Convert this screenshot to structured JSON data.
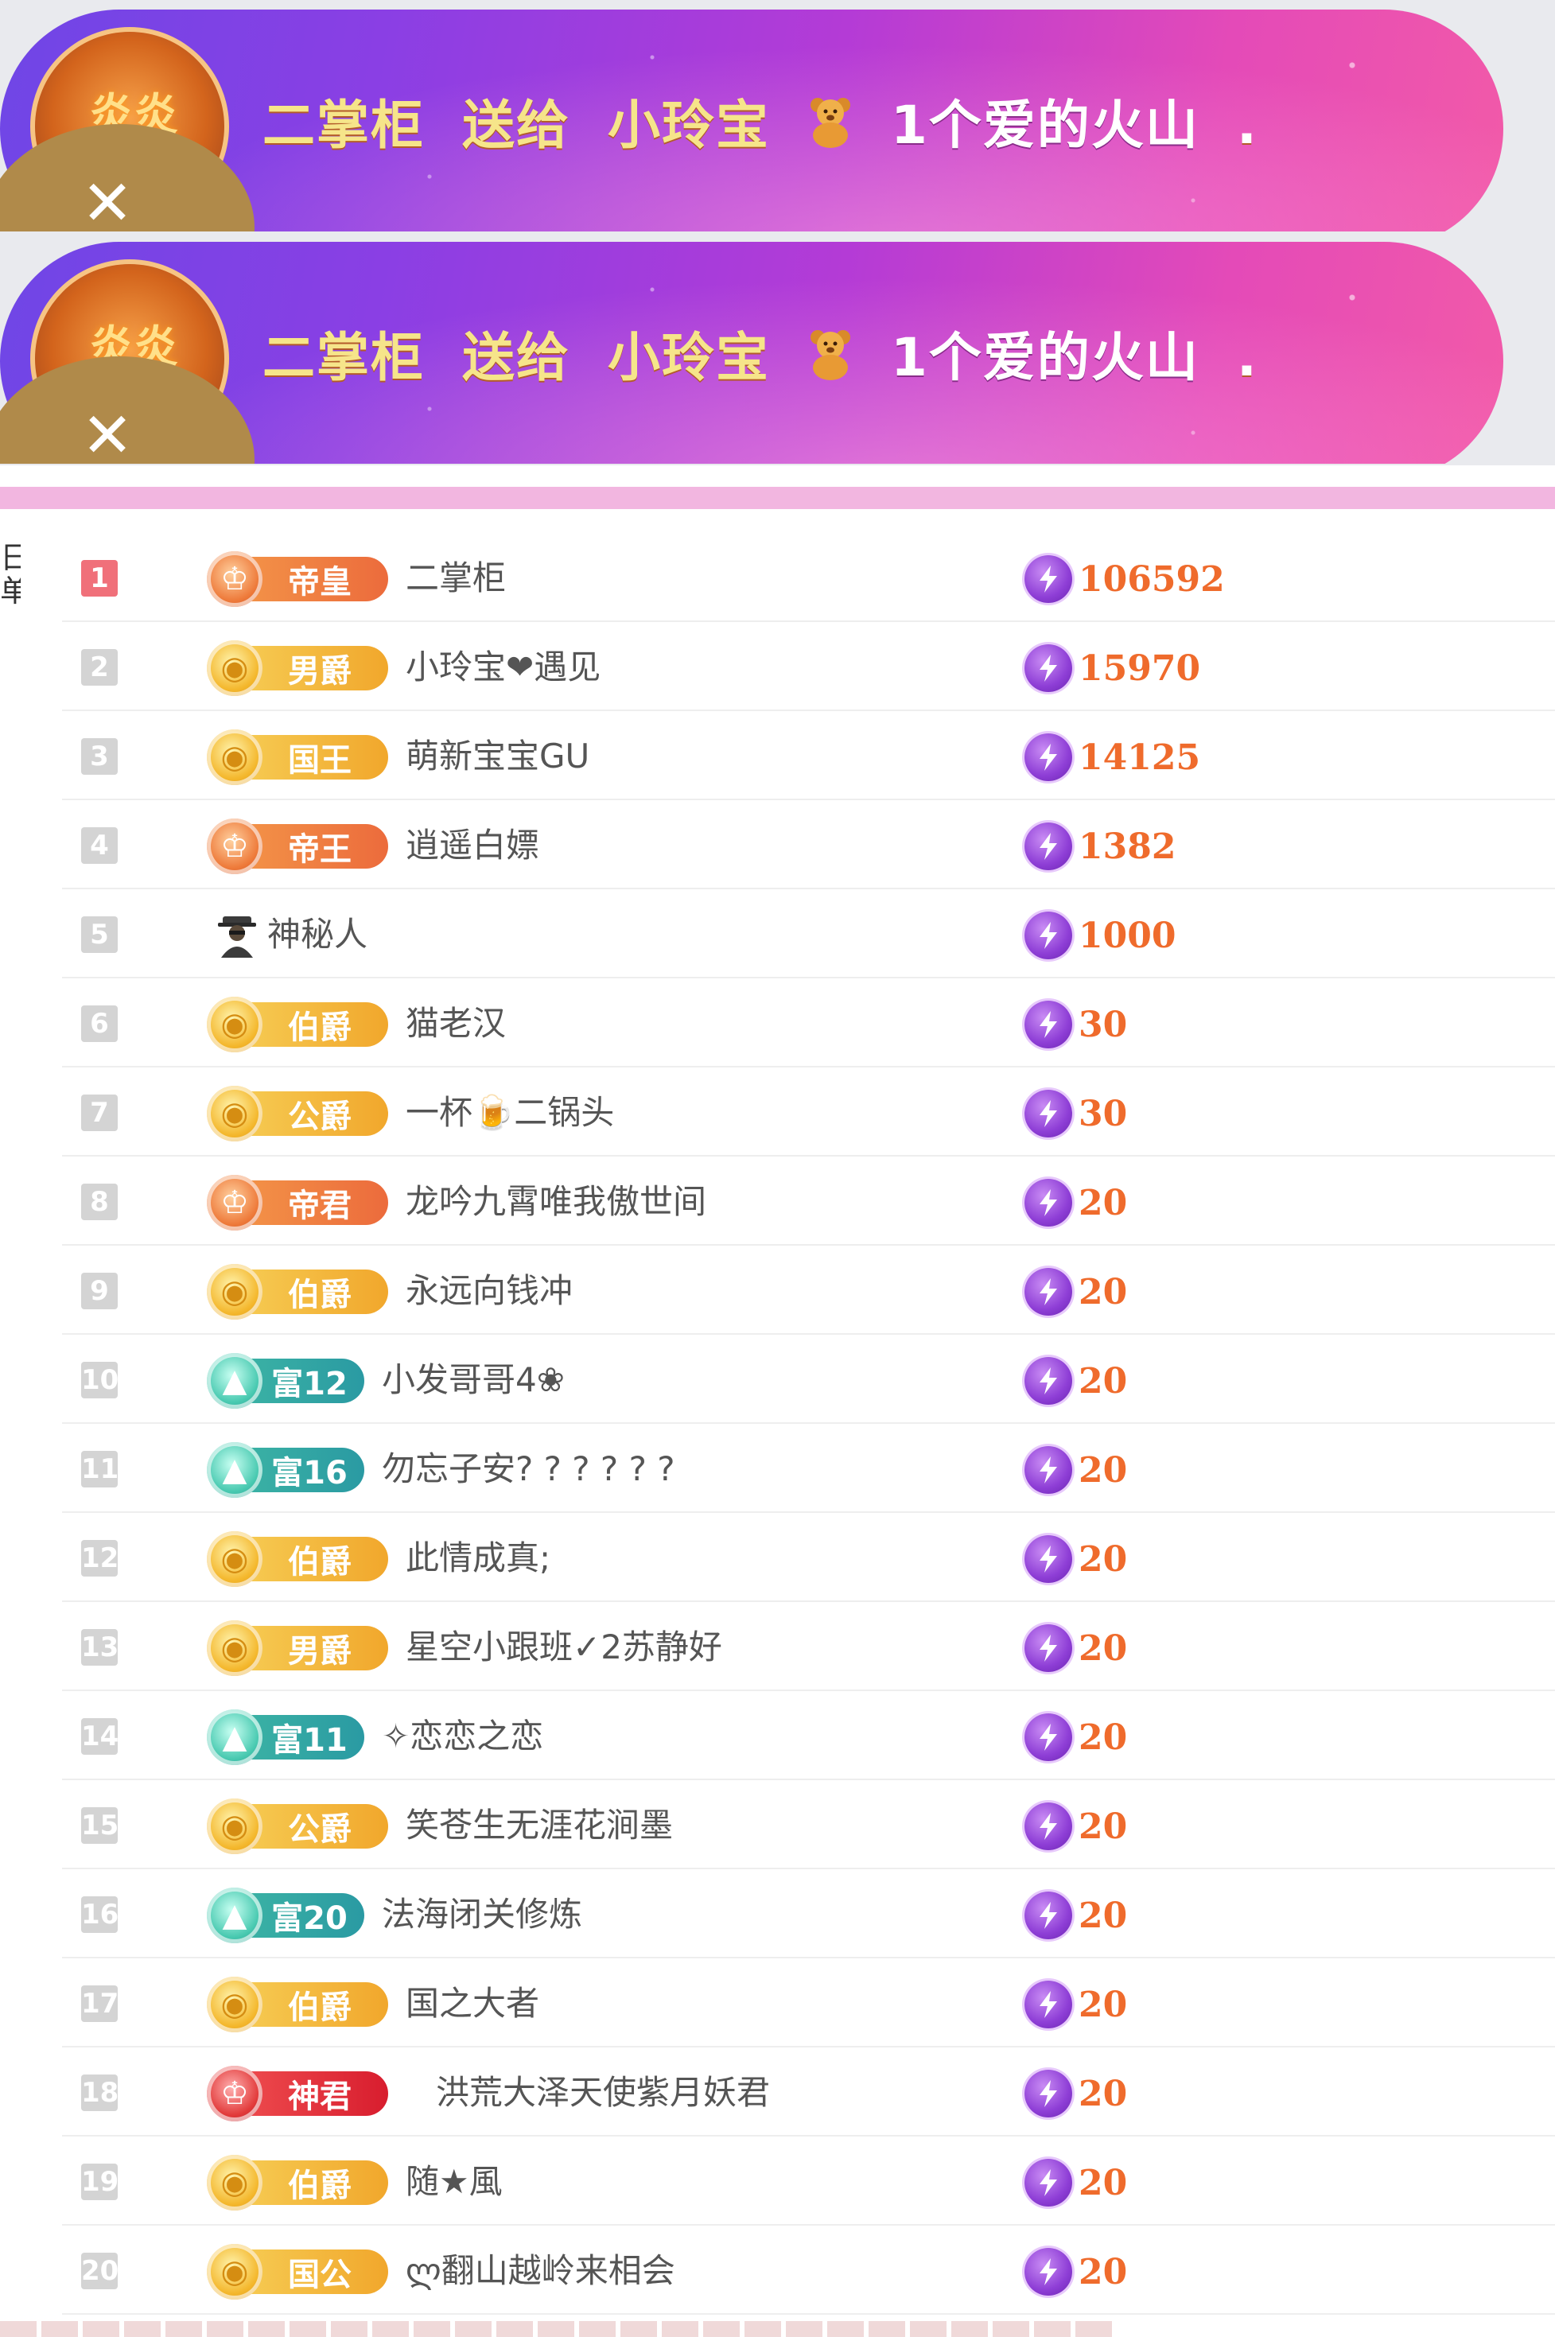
{
  "banners": [
    {
      "sender": "二掌柜",
      "verb": "送给",
      "receiver": "小玲宝",
      "gift": "1个爱的火山",
      "dot": ".",
      "badge_text": "炎炎",
      "close_glyph": "✕"
    },
    {
      "sender": "二掌柜",
      "verb": "送给",
      "receiver": "小玲宝",
      "gift": "1个爱的火山",
      "dot": ".",
      "badge_text": "炎炎",
      "close_glyph": "✕"
    }
  ],
  "side_label": "日单",
  "ranking": [
    {
      "rank": "1",
      "badge_type": "orange",
      "badge_title": "帝皇",
      "name": "二掌柜",
      "score": "106592"
    },
    {
      "rank": "2",
      "badge_type": "gold",
      "badge_title": "男爵",
      "name": "小玲宝❤遇见",
      "score": "15970"
    },
    {
      "rank": "3",
      "badge_type": "gold",
      "badge_title": "国王",
      "name": "萌新宝宝GU",
      "score": "14125"
    },
    {
      "rank": "4",
      "badge_type": "orange",
      "badge_title": "帝王",
      "name": "逍遥白嫖",
      "score": "1382"
    },
    {
      "rank": "5",
      "badge_type": "mystery",
      "badge_title": "",
      "name": "神秘人",
      "score": "1000"
    },
    {
      "rank": "6",
      "badge_type": "gold",
      "badge_title": "伯爵",
      "name": "猫老汉",
      "score": "30"
    },
    {
      "rank": "7",
      "badge_type": "gold",
      "badge_title": "公爵",
      "name": "一杯🍺二锅头",
      "score": "30"
    },
    {
      "rank": "8",
      "badge_type": "orange",
      "badge_title": "帝君",
      "name": "龙吟九霄唯我傲世间",
      "score": "20"
    },
    {
      "rank": "9",
      "badge_type": "gold",
      "badge_title": "伯爵",
      "name": "永远向钱冲",
      "score": "20"
    },
    {
      "rank": "10",
      "badge_type": "teal",
      "badge_title": "富12",
      "name": "小发哥哥4❀",
      "score": "20"
    },
    {
      "rank": "11",
      "badge_type": "teal",
      "badge_title": "富16",
      "name": "勿忘子安? ? ? ? ? ?",
      "score": "20"
    },
    {
      "rank": "12",
      "badge_type": "gold",
      "badge_title": "伯爵",
      "name": "此情成真;",
      "score": "20"
    },
    {
      "rank": "13",
      "badge_type": "gold",
      "badge_title": "男爵",
      "name": "星空小跟班✓2苏静好",
      "score": "20"
    },
    {
      "rank": "14",
      "badge_type": "teal",
      "badge_title": "富11",
      "name": "✧恋恋之恋",
      "score": "20"
    },
    {
      "rank": "15",
      "badge_type": "gold",
      "badge_title": "公爵",
      "name": "笑苍生无涯花涧墨",
      "score": "20"
    },
    {
      "rank": "16",
      "badge_type": "teal",
      "badge_title": "富20",
      "name": "法海闭关修炼",
      "score": "20"
    },
    {
      "rank": "17",
      "badge_type": "gold",
      "badge_title": "伯爵",
      "name": "国之大者",
      "score": "20"
    },
    {
      "rank": "18",
      "badge_type": "red",
      "badge_title": "神君",
      "name": "洪荒大泽天使紫月妖君",
      "score": "20"
    },
    {
      "rank": "19",
      "badge_type": "gold",
      "badge_title": "伯爵",
      "name": "随★風",
      "score": "20"
    },
    {
      "rank": "20",
      "badge_type": "gold",
      "badge_title": "国公",
      "name": "ლ翻山越岭来相会",
      "score": "20"
    }
  ],
  "colors": {
    "accent_score": "#ef6b2c",
    "rank_first": "#f0707a",
    "rank_default": "#d4d4d4",
    "divider": "#f2b6e0"
  },
  "icons": {
    "score": "lightning-bolt-icon",
    "mystery": "masked-person-icon",
    "gift_receiver": "teddy-bear-icon"
  }
}
